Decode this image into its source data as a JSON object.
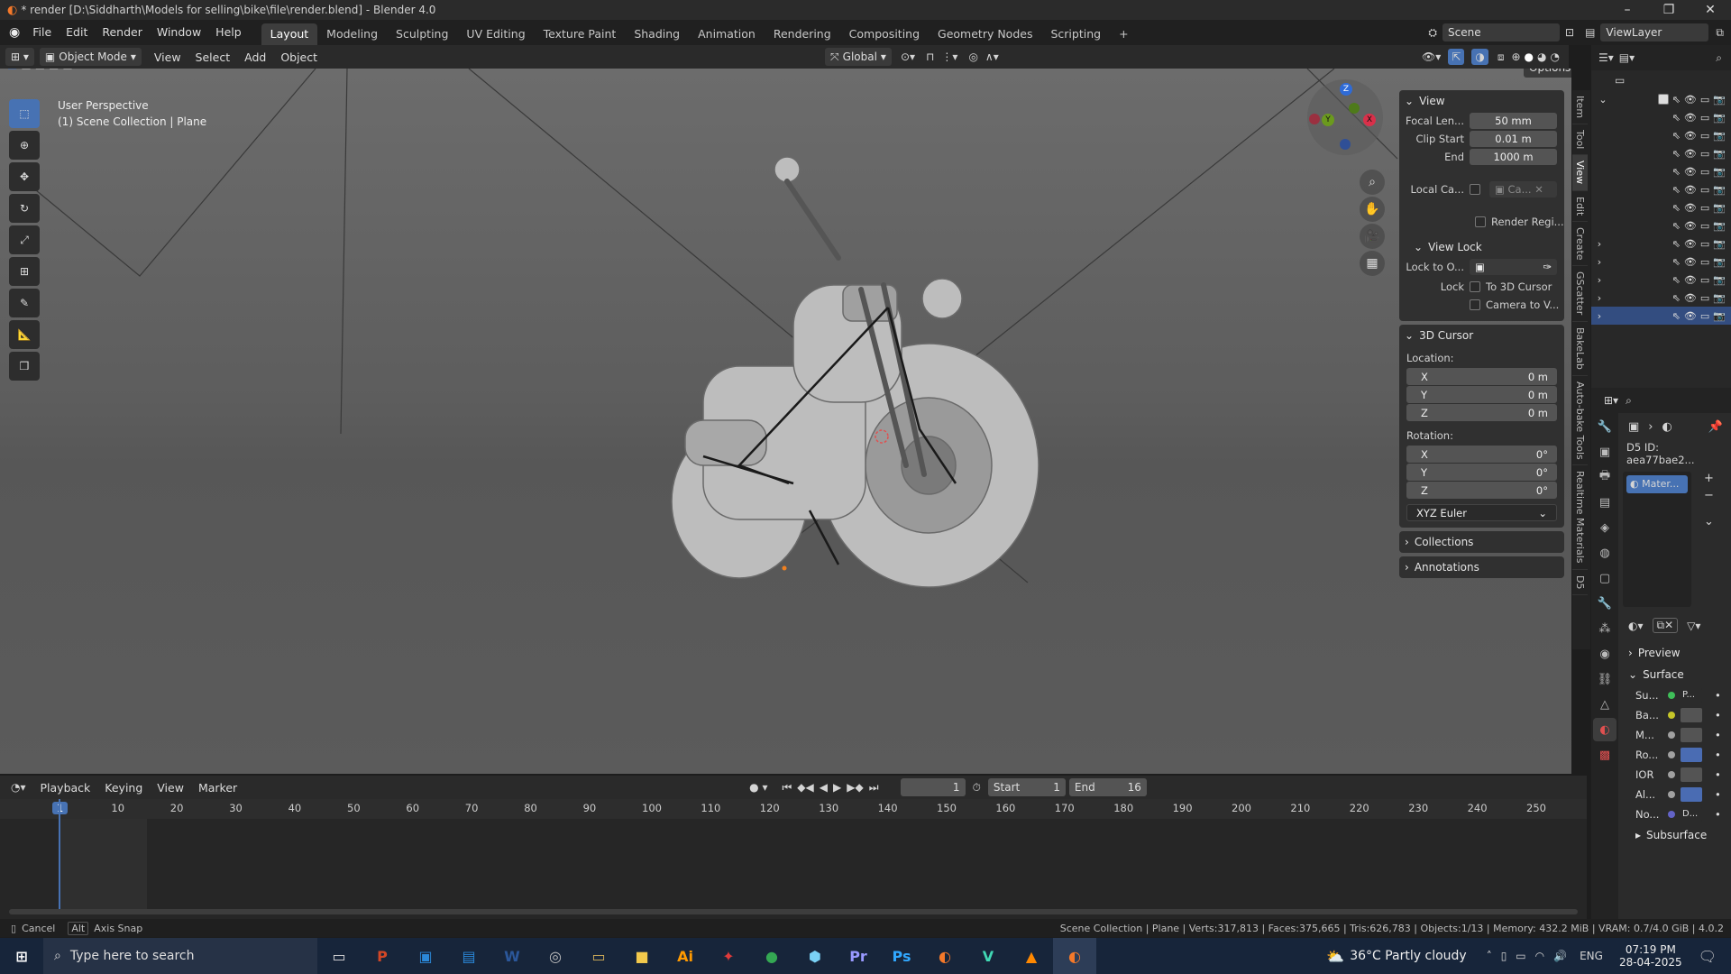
{
  "window": {
    "title": "* render [D:\\Siddharth\\Models for selling\\bike\\file\\render.blend] - Blender 4.0",
    "minimize": "–",
    "maximize": "❐",
    "close": "✕"
  },
  "menu": {
    "items": [
      "File",
      "Edit",
      "Render",
      "Window",
      "Help"
    ]
  },
  "workspaces": {
    "tabs": [
      "Layout",
      "Modeling",
      "Sculpting",
      "UV Editing",
      "Texture Paint",
      "Shading",
      "Animation",
      "Rendering",
      "Compositing",
      "Geometry Nodes",
      "Scripting"
    ],
    "active": "Layout",
    "add": "+"
  },
  "scene": {
    "label": "Scene",
    "viewlayer": "ViewLayer"
  },
  "header3d": {
    "mode": "Object Mode",
    "menus": [
      "View",
      "Select",
      "Add",
      "Object"
    ],
    "orientation": "Global",
    "options": "Options"
  },
  "viewport": {
    "perspective": "User Perspective",
    "context": "(1) Scene Collection | Plane"
  },
  "gizmo": {
    "z": "Z",
    "y": "Y",
    "x": "X"
  },
  "npanel": {
    "view": {
      "title": "View",
      "focal_label": "Focal Len...",
      "focal": "50 mm",
      "clip_start_label": "Clip Start",
      "clip_start": "0.01 m",
      "end_label": "End",
      "end": "1000 m",
      "local_cam_label": "Local Ca...",
      "local_cam_value": "Ca...",
      "render_region": "Render Regi..."
    },
    "viewlock": {
      "title": "View Lock",
      "lock_to_label": "Lock to O...",
      "lock_label": "Lock",
      "to_cursor": "To 3D Cursor",
      "camera_to": "Camera to V..."
    },
    "cursor": {
      "title": "3D Cursor",
      "location": "Location:",
      "rotation": "Rotation:",
      "loc": [
        {
          "axis": "X",
          "value": "0 m"
        },
        {
          "axis": "Y",
          "value": "0 m"
        },
        {
          "axis": "Z",
          "value": "0 m"
        }
      ],
      "rot": [
        {
          "axis": "X",
          "value": "0°"
        },
        {
          "axis": "Y",
          "value": "0°"
        },
        {
          "axis": "Z",
          "value": "0°"
        }
      ],
      "mode": "XYZ Euler"
    },
    "collections": "Collections",
    "annotations": "Annotations"
  },
  "vtabs": [
    "Item",
    "Tool",
    "View",
    "Edit",
    "Create",
    "GScatter",
    "BakeLab",
    "Auto-bake Tools",
    "Realtime Materials",
    "D5"
  ],
  "properties": {
    "d5id": "D5 ID: aea77bae2...",
    "slot": "Mater...",
    "preview": "Preview",
    "surface": "Surface",
    "rows": [
      {
        "label": "Su...",
        "value": "P...",
        "color": "#3fbf59"
      },
      {
        "label": "Ba...",
        "value": "",
        "color": "#c7c729"
      },
      {
        "label": "M...",
        "value": "",
        "color": "#a1a1a1"
      },
      {
        "label": "Ro...",
        "value": "",
        "color": "#a1a1a1"
      },
      {
        "label": "IOR",
        "value": "",
        "color": "#a1a1a1"
      },
      {
        "label": "Al...",
        "value": "",
        "color": "#a1a1a1"
      },
      {
        "label": "No...",
        "value": "D...",
        "color": "#6363c7"
      }
    ],
    "subsurface": "Subsurface"
  },
  "timeline": {
    "menus": [
      "Playback",
      "Keying",
      "View",
      "Marker"
    ],
    "current": "1",
    "start_label": "Start",
    "start": "1",
    "end_label": "End",
    "end": "16",
    "ticks": [
      "1",
      "10",
      "20",
      "30",
      "40",
      "50",
      "60",
      "70",
      "80",
      "90",
      "100",
      "110",
      "120",
      "130",
      "140",
      "150",
      "160",
      "170",
      "180",
      "190",
      "200",
      "210",
      "220",
      "230",
      "240",
      "250"
    ]
  },
  "status": {
    "cancel": "Cancel",
    "alt": "Alt",
    "axis_snap": "Axis Snap",
    "stats": "Scene Collection | Plane | Verts:317,813 | Faces:375,665 | Tris:626,783 | Objects:1/13 | Memory: 432.2 MiB | VRAM: 0.7/4.0 GiB | 4.0.2"
  },
  "taskbar": {
    "search_placeholder": "Type here to search",
    "weather": "36°C  Partly cloudy",
    "lang": "ENG",
    "time": "07:19 PM",
    "date": "28-04-2025",
    "apps": [
      {
        "glyph": "P",
        "color": "#d24726"
      },
      {
        "glyph": "▣",
        "color": "#2b88d8"
      },
      {
        "glyph": "▤",
        "color": "#2b88d8"
      },
      {
        "glyph": "W",
        "color": "#2b579a"
      },
      {
        "glyph": "◎",
        "color": "#c0c0c0"
      },
      {
        "glyph": "▭",
        "color": "#d8b35a"
      },
      {
        "glyph": "■",
        "color": "#f2c94c"
      },
      {
        "glyph": "Ai",
        "color": "#ff9a00"
      },
      {
        "glyph": "✦",
        "color": "#e03a3a"
      },
      {
        "glyph": "●",
        "color": "#34a853"
      },
      {
        "glyph": "⬢",
        "color": "#7ad1f5"
      },
      {
        "glyph": "Pr",
        "color": "#9999ff"
      },
      {
        "glyph": "Ps",
        "color": "#31a8ff"
      },
      {
        "glyph": "◐",
        "color": "#f5792a"
      },
      {
        "glyph": "V",
        "color": "#41d9b5"
      },
      {
        "glyph": "▲",
        "color": "#ff8800"
      },
      {
        "glyph": "◐",
        "color": "#f5792a"
      }
    ]
  },
  "colors": {
    "accent": "#4772b3",
    "selected_row": "#334d80"
  }
}
